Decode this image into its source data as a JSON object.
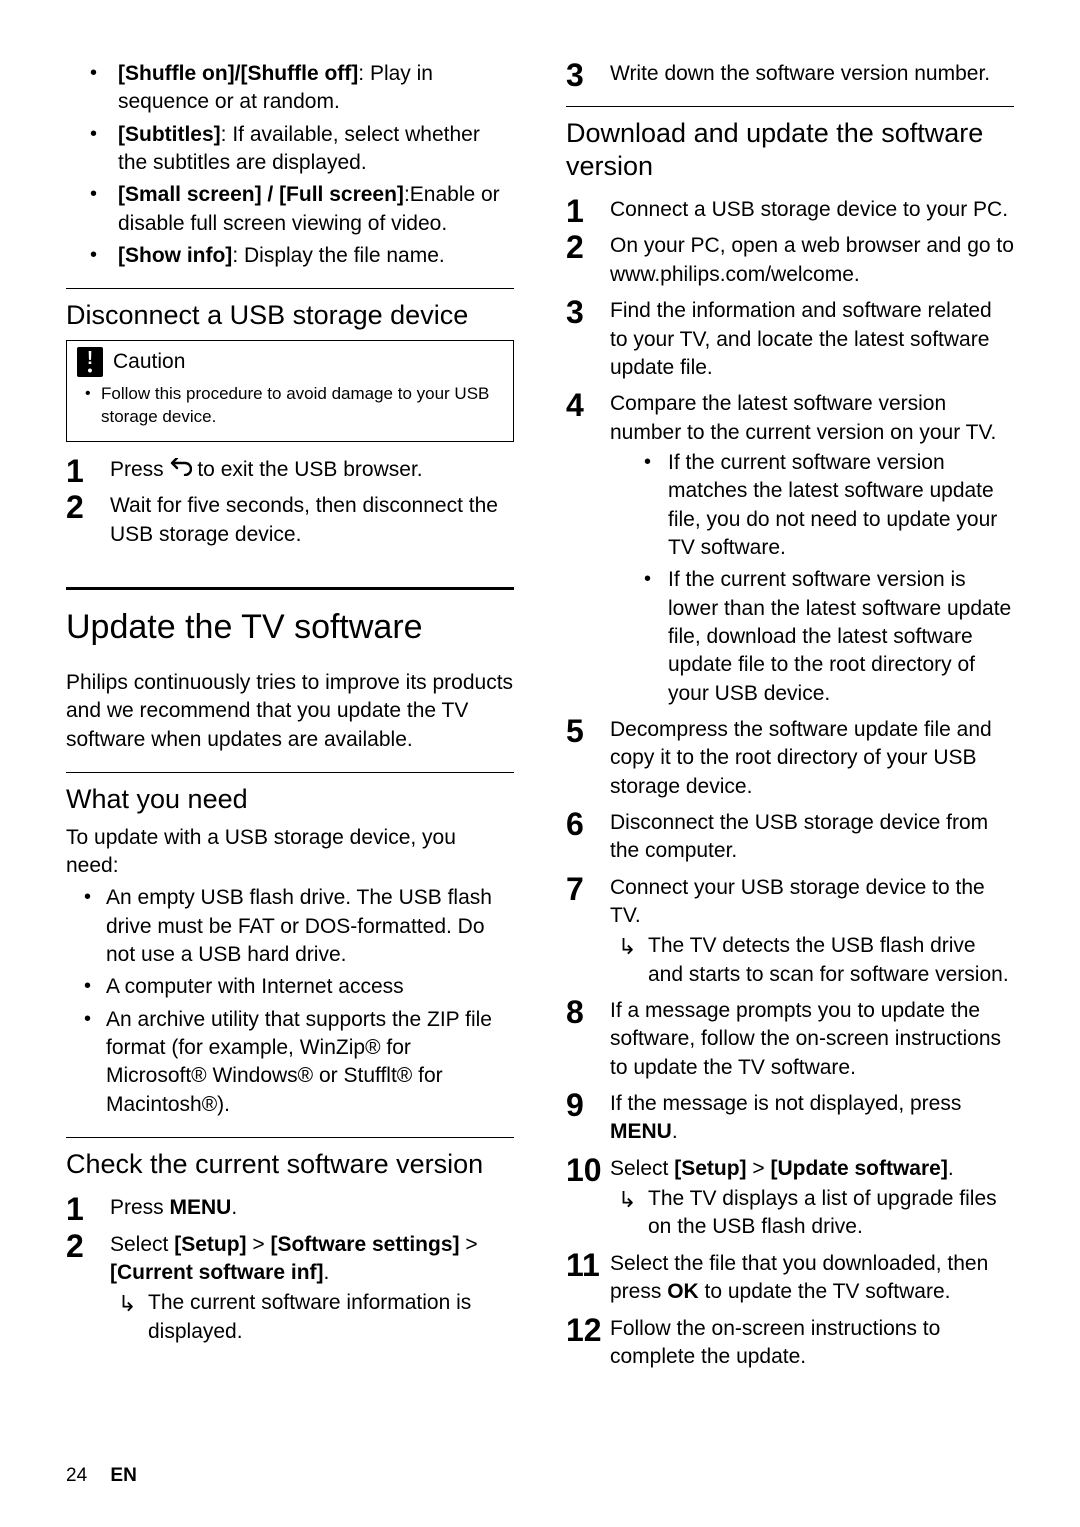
{
  "col1": {
    "options": [
      {
        "label": "[Shuffle on]/[Shuffle off]",
        "desc": ": Play in sequence or at random."
      },
      {
        "label": "[Subtitles]",
        "desc": ": If available, select whether the subtitles are displayed."
      },
      {
        "label": "[Small screen] / [Full screen]",
        "desc": ":Enable or disable full screen viewing of video."
      },
      {
        "label": "[Show info]",
        "desc": ": Display the file name."
      }
    ],
    "disc_h": "Disconnect a USB storage device",
    "caution_title": "Caution",
    "caution_body": "Follow this procedure to avoid damage to your USB storage device.",
    "disc_steps": {
      "s1a": "Press ",
      "s1b": " to exit the USB browser.",
      "s2": "Wait for five seconds, then disconnect the USB storage device."
    },
    "update_h": "Update the TV software",
    "update_intro": "Philips continuously tries to improve its products and we recommend that you update the TV software when updates are available.",
    "need_h": "What you need",
    "need_intro": "To update with a USB storage device, you need:",
    "need_items": [
      "An empty USB flash drive. The USB flash drive must be FAT or DOS-formatted. Do not use a USB hard drive.",
      "A computer with Internet access",
      "An archive utility that supports the ZIP file format (for example, WinZip® for Microsoft® Windows® or Stufflt® for Macintosh®)."
    ],
    "check_h": "Check the current software version",
    "check_steps": {
      "s1a": "Press ",
      "s1b": "MENU",
      "s1c": ".",
      "s2a": "Select ",
      "s2b": "[Setup]",
      "s2c": " > ",
      "s2d": "[Software settings]",
      "s2e": " > ",
      "s2f": "[Current software inf]",
      "s2g": ".",
      "s2_sub": "The current software information is displayed."
    }
  },
  "col2": {
    "step3": "Write down the software version number.",
    "dl_h": "Download and update the software version",
    "steps": {
      "s1": "Connect a USB storage device to your PC.",
      "s2": "On your PC, open a web browser and go to www.philips.com/welcome.",
      "s3": "Find the information and software related to your TV, and locate the latest software update file.",
      "s4": "Compare the latest software version number to the current version on your TV.",
      "s4_b1": "If the current software version matches the latest software update file, you do not need to update your TV software.",
      "s4_b2": "If the current software version is lower than the latest software update file, download the latest software update file to the root directory of your USB device.",
      "s5": "Decompress the software update file and copy it to the root directory of your USB storage device.",
      "s6": "Disconnect the USB storage device from the computer.",
      "s7": "Connect your USB storage device to the TV.",
      "s7_sub": "The TV detects the USB flash drive and starts to scan for software version.",
      "s8": "If a message prompts you to update the software, follow the on-screen instructions to update the TV software.",
      "s9a": "If the message is not displayed, press ",
      "s9b": "MENU",
      "s9c": ".",
      "s10a": "Select ",
      "s10b": "[Setup]",
      "s10c": " > ",
      "s10d": "[Update software]",
      "s10e": ".",
      "s10_sub": "The TV displays a list of upgrade files on the USB flash drive.",
      "s11a": "Select the file that you downloaded, then press ",
      "s11b": "OK",
      "s11c": " to update the TV software.",
      "s12": "Follow the on-screen instructions to complete the update."
    }
  },
  "footer": {
    "page": "24",
    "lang": "EN"
  }
}
